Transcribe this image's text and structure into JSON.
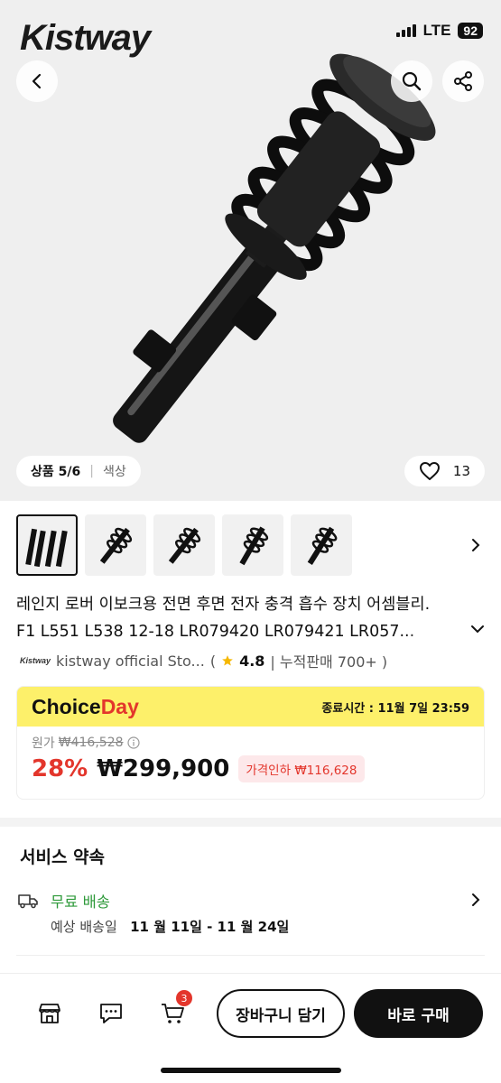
{
  "status_bar": {
    "network": "LTE",
    "battery": "92"
  },
  "brand": {
    "logo_text": "Kistway"
  },
  "gallery": {
    "position_label": "상품 5/6",
    "color_label": "색상",
    "likes": "13",
    "watermark": "Kistway"
  },
  "product": {
    "title_line1": "레인지 로버 이보크용 전면 후면 전자 충격 흡수 장치 어셈블리.",
    "title_line2": "F1 L551 L538 12-18 LR079420 LR079421 LR057..."
  },
  "store": {
    "logo_text": "Kistway",
    "name": "kistway official Sto...",
    "paren_open": "(",
    "rating": "4.8",
    "sales": "| 누적판매 700+ )"
  },
  "deal": {
    "brand_choice": "Choice",
    "brand_day": "Day",
    "end_time": "종료시간 : 11월 7일 23:59",
    "orig_label": "원가",
    "orig_price": "₩416,528",
    "discount": "28%",
    "price": "₩299,900",
    "price_drop": "가격인하 ₩116,628"
  },
  "service": {
    "title": "서비스 약속",
    "shipping_label": "무료 배송",
    "eta_label": "예상 배송일",
    "eta_range": "11 월 11일 - 11 월 24일"
  },
  "bottom_bar": {
    "cart_count": "3",
    "add_to_cart": "장바구니 담기",
    "buy_now": "바로 구매"
  },
  "colors": {
    "accent_red": "#e3362c",
    "choice_yellow": "#fdf06a",
    "shipping_green": "#2e9a3a"
  },
  "icons": [
    "back-icon",
    "search-icon",
    "share-icon",
    "heart-icon",
    "chevron-right-icon",
    "chevron-down-icon",
    "star-icon",
    "info-icon",
    "truck-icon",
    "store-icon",
    "chat-icon",
    "cart-icon"
  ]
}
